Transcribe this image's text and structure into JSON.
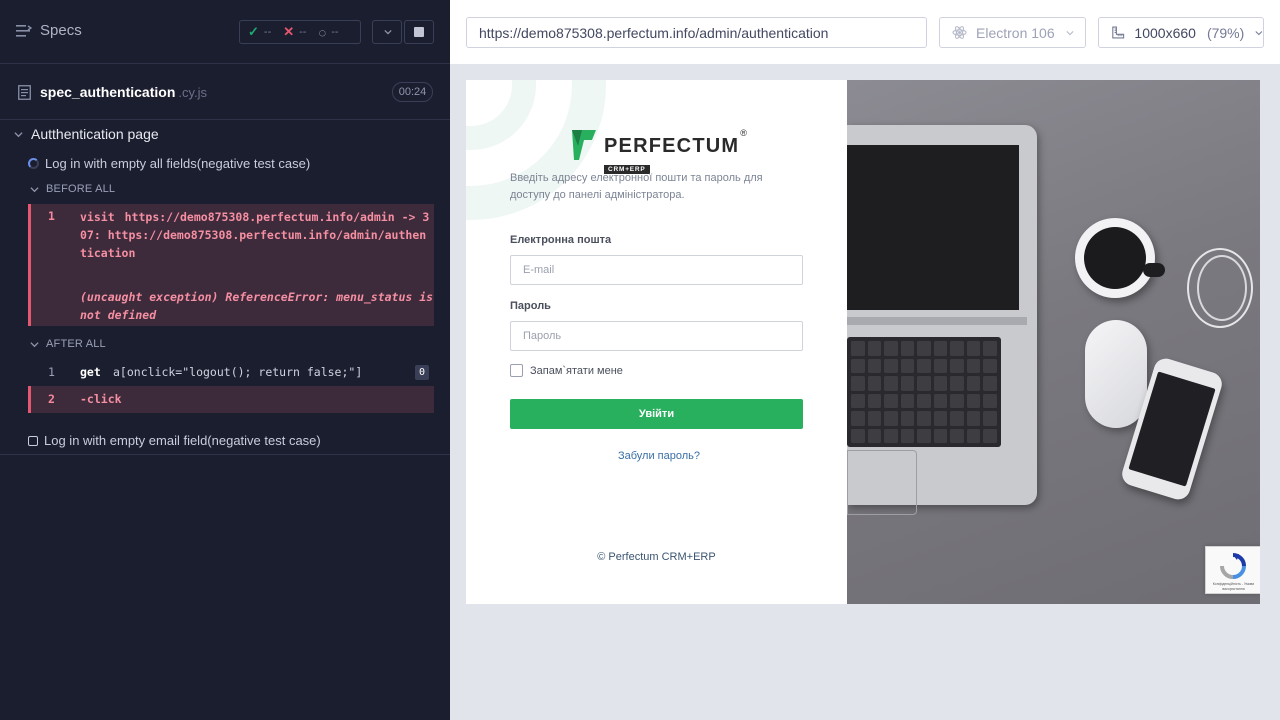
{
  "reporter": {
    "specs_label": "Specs",
    "stats": {
      "passed": "--",
      "failed": "--",
      "pending": "--"
    },
    "spec_file": {
      "name": "spec_authentication",
      "ext": ".cy.js",
      "duration": "00:24"
    },
    "suite": {
      "title": "Autthentication page",
      "tests": [
        {
          "title": "Log in with empty all fields(negative test case)",
          "status": "running",
          "hooks": [
            {
              "label": "BEFORE ALL",
              "commands": [
                {
                  "num": "1",
                  "name": "visit",
                  "message": "https://demo875308.perfectum.info/admin -> 307: https://demo875308.perfectum.info/admin/authentication",
                  "error": "(uncaught exception)  ReferenceError: menu_status is not defined",
                  "state": "failed"
                }
              ]
            },
            {
              "label": "AFTER ALL",
              "commands": [
                {
                  "num": "1",
                  "name": "get",
                  "message": "a[onclick=\"logout(); return false;\"]",
                  "count": "0",
                  "state": "pending"
                },
                {
                  "num": "2",
                  "name": "-click",
                  "state": "failed"
                }
              ]
            }
          ]
        },
        {
          "title": "Log in with empty email field(negative test case)",
          "status": "pending"
        }
      ]
    }
  },
  "aut_header": {
    "url": "https://demo875308.perfectum.info/admin/authentication",
    "browser": "Electron 106",
    "viewport": "1000x660",
    "scale": "(79%)"
  },
  "login_page": {
    "brand": {
      "name": "PERFECTUM",
      "sub": "CRM+ERP",
      "reg": "®"
    },
    "intro": "Введіть адресу електронної пошти та пароль для доступу до панелі адміністратора.",
    "email_label": "Електронна пошта",
    "email_placeholder": "E-mail",
    "password_label": "Пароль",
    "password_placeholder": "Пароль",
    "remember_label": "Запам`ятати мене",
    "login_button": "Увійти",
    "forgot_link": "Забули пароль?",
    "copyright": "© Perfectum CRM+ERP",
    "recaptcha_text": "Конфіденційність - Умови використання"
  },
  "colors": {
    "reporter_bg": "#1b1e2e",
    "error_text": "#f58fa2",
    "error_bg": "#3d2a3b",
    "login_button": "#29b05f",
    "brand_green": "#29b05f"
  }
}
